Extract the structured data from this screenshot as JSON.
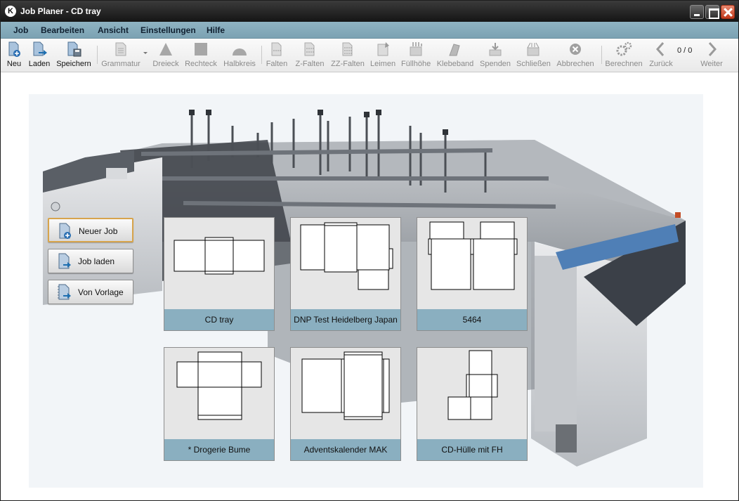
{
  "window": {
    "title": "Job Planer - CD tray",
    "app_icon_letter": "K"
  },
  "menu": [
    "Job",
    "Bearbeiten",
    "Ansicht",
    "Einstellungen",
    "Hilfe"
  ],
  "toolbar": {
    "items": [
      {
        "label": "Neu",
        "icon": "new-document-icon",
        "enabled": true
      },
      {
        "label": "Laden",
        "icon": "open-document-icon",
        "enabled": true
      },
      {
        "label": "Speichern",
        "icon": "save-icon",
        "enabled": true
      },
      {
        "label": "Grammatur",
        "icon": "grammage-icon",
        "enabled": false
      },
      {
        "label": "Dreieck",
        "icon": "triangle-icon",
        "enabled": false
      },
      {
        "label": "Rechteck",
        "icon": "rectangle-icon",
        "enabled": false
      },
      {
        "label": "Halbkreis",
        "icon": "half-circle-icon",
        "enabled": false
      },
      {
        "label": "Falten",
        "icon": "fold-icon",
        "enabled": false
      },
      {
        "label": "Z-Falten",
        "icon": "z-fold-icon",
        "enabled": false
      },
      {
        "label": "ZZ-Falten",
        "icon": "zz-fold-icon",
        "enabled": false
      },
      {
        "label": "Leimen",
        "icon": "glue-icon",
        "enabled": false
      },
      {
        "label": "Füllhöhe",
        "icon": "fill-height-icon",
        "enabled": false
      },
      {
        "label": "Klebeband",
        "icon": "tape-icon",
        "enabled": false
      },
      {
        "label": "Spenden",
        "icon": "dispense-icon",
        "enabled": false
      },
      {
        "label": "Schließen",
        "icon": "close-box-icon",
        "enabled": false
      },
      {
        "label": "Abbrechen",
        "icon": "cancel-icon",
        "enabled": false
      },
      {
        "label": "Berechnen",
        "icon": "gears-icon",
        "enabled": false
      },
      {
        "label": "Zurück",
        "icon": "chevron-left-icon",
        "enabled": false
      },
      {
        "label": "Weiter",
        "icon": "chevron-right-icon",
        "enabled": false
      }
    ],
    "pager": "0 / 0"
  },
  "actions": [
    {
      "label": "Neuer Job",
      "icon": "new-job-icon"
    },
    {
      "label": "Job laden",
      "icon": "load-job-icon"
    },
    {
      "label": "Von Vorlage",
      "icon": "template-icon"
    }
  ],
  "jobs": [
    {
      "label": "CD tray"
    },
    {
      "label": "DNP Test Heidelberg Japan"
    },
    {
      "label": "5464"
    },
    {
      "label": "* Drogerie Bume"
    },
    {
      "label": "Adventskalender MAK"
    },
    {
      "label": "CD-Hülle mit FH"
    }
  ]
}
